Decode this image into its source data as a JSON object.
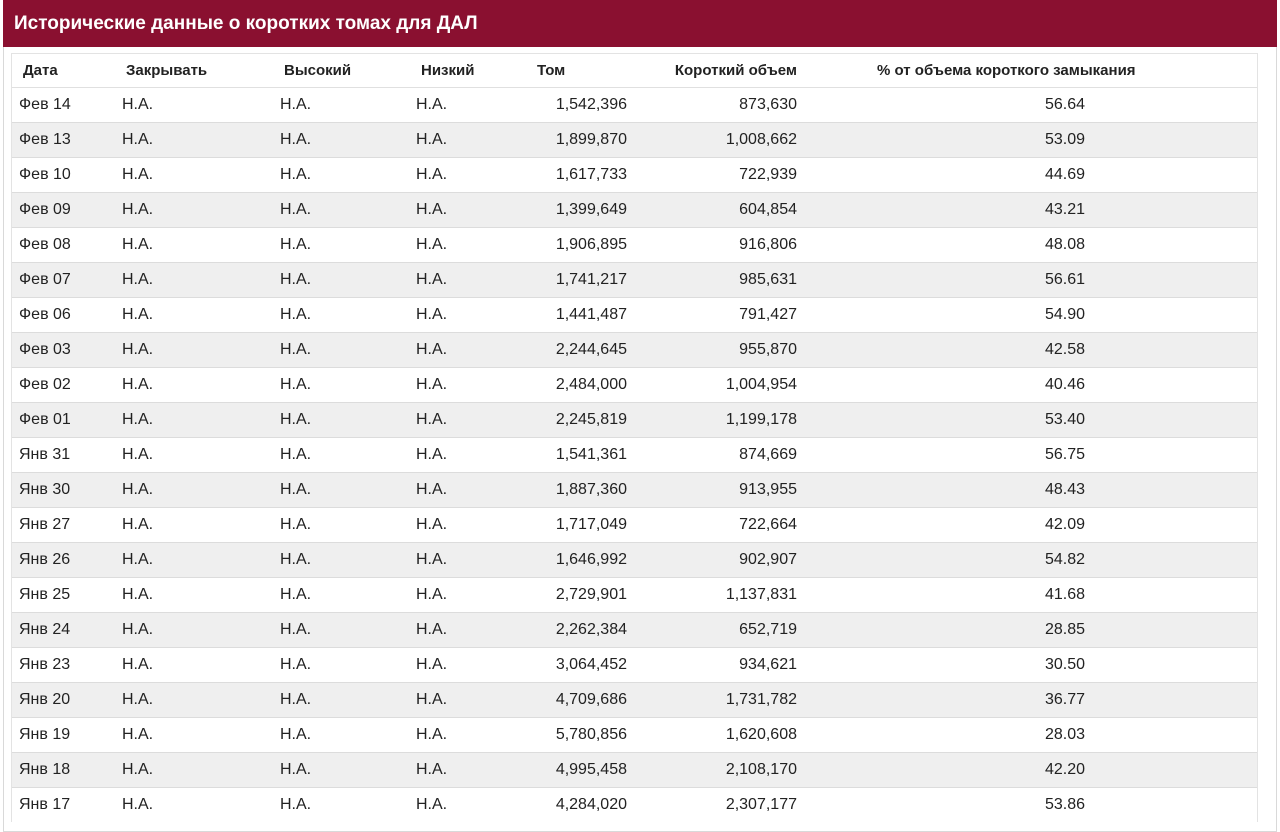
{
  "page": {
    "title": "Исторические данные о коротких томах для ДАЛ"
  },
  "table": {
    "headers": {
      "date": "Дата",
      "close": "Закрывать",
      "high": "Высокий",
      "low": "Низкий",
      "volume": "Том",
      "short_volume": "Короткий объем",
      "short_pct": "% от объема короткого замыкания"
    },
    "rows": [
      {
        "date": "Фев 14",
        "close": "Н.А.",
        "high": "Н.А.",
        "low": "Н.А.",
        "volume": "1,542,396",
        "short_volume": "873,630",
        "short_pct": "56.64"
      },
      {
        "date": "Фев 13",
        "close": "Н.А.",
        "high": "Н.А.",
        "low": "Н.А.",
        "volume": "1,899,870",
        "short_volume": "1,008,662",
        "short_pct": "53.09"
      },
      {
        "date": "Фев 10",
        "close": "Н.А.",
        "high": "Н.А.",
        "low": "Н.А.",
        "volume": "1,617,733",
        "short_volume": "722,939",
        "short_pct": "44.69"
      },
      {
        "date": "Фев 09",
        "close": "Н.А.",
        "high": "Н.А.",
        "low": "Н.А.",
        "volume": "1,399,649",
        "short_volume": "604,854",
        "short_pct": "43.21"
      },
      {
        "date": "Фев 08",
        "close": "Н.А.",
        "high": "Н.А.",
        "low": "Н.А.",
        "volume": "1,906,895",
        "short_volume": "916,806",
        "short_pct": "48.08"
      },
      {
        "date": "Фев 07",
        "close": "Н.А.",
        "high": "Н.А.",
        "low": "Н.А.",
        "volume": "1,741,217",
        "short_volume": "985,631",
        "short_pct": "56.61"
      },
      {
        "date": "Фев 06",
        "close": "Н.А.",
        "high": "Н.А.",
        "low": "Н.А.",
        "volume": "1,441,487",
        "short_volume": "791,427",
        "short_pct": "54.90"
      },
      {
        "date": "Фев 03",
        "close": "Н.А.",
        "high": "Н.А.",
        "low": "Н.А.",
        "volume": "2,244,645",
        "short_volume": "955,870",
        "short_pct": "42.58"
      },
      {
        "date": "Фев 02",
        "close": "Н.А.",
        "high": "Н.А.",
        "low": "Н.А.",
        "volume": "2,484,000",
        "short_volume": "1,004,954",
        "short_pct": "40.46"
      },
      {
        "date": "Фев 01",
        "close": "Н.А.",
        "high": "Н.А.",
        "low": "Н.А.",
        "volume": "2,245,819",
        "short_volume": "1,199,178",
        "short_pct": "53.40"
      },
      {
        "date": "Янв 31",
        "close": "Н.А.",
        "high": "Н.А.",
        "low": "Н.А.",
        "volume": "1,541,361",
        "short_volume": "874,669",
        "short_pct": "56.75"
      },
      {
        "date": "Янв 30",
        "close": "Н.А.",
        "high": "Н.А.",
        "low": "Н.А.",
        "volume": "1,887,360",
        "short_volume": "913,955",
        "short_pct": "48.43"
      },
      {
        "date": "Янв 27",
        "close": "Н.А.",
        "high": "Н.А.",
        "low": "Н.А.",
        "volume": "1,717,049",
        "short_volume": "722,664",
        "short_pct": "42.09"
      },
      {
        "date": "Янв 26",
        "close": "Н.А.",
        "high": "Н.А.",
        "low": "Н.А.",
        "volume": "1,646,992",
        "short_volume": "902,907",
        "short_pct": "54.82"
      },
      {
        "date": "Янв 25",
        "close": "Н.А.",
        "high": "Н.А.",
        "low": "Н.А.",
        "volume": "2,729,901",
        "short_volume": "1,137,831",
        "short_pct": "41.68"
      },
      {
        "date": "Янв 24",
        "close": "Н.А.",
        "high": "Н.А.",
        "low": "Н.А.",
        "volume": "2,262,384",
        "short_volume": "652,719",
        "short_pct": "28.85"
      },
      {
        "date": "Янв 23",
        "close": "Н.А.",
        "high": "Н.А.",
        "low": "Н.А.",
        "volume": "3,064,452",
        "short_volume": "934,621",
        "short_pct": "30.50"
      },
      {
        "date": "Янв 20",
        "close": "Н.А.",
        "high": "Н.А.",
        "low": "Н.А.",
        "volume": "4,709,686",
        "short_volume": "1,731,782",
        "short_pct": "36.77"
      },
      {
        "date": "Янв 19",
        "close": "Н.А.",
        "high": "Н.А.",
        "low": "Н.А.",
        "volume": "5,780,856",
        "short_volume": "1,620,608",
        "short_pct": "28.03"
      },
      {
        "date": "Янв 18",
        "close": "Н.А.",
        "high": "Н.А.",
        "low": "Н.А.",
        "volume": "4,995,458",
        "short_volume": "2,108,170",
        "short_pct": "42.20"
      },
      {
        "date": "Янв 17",
        "close": "Н.А.",
        "high": "Н.А.",
        "low": "Н.А.",
        "volume": "4,284,020",
        "short_volume": "2,307,177",
        "short_pct": "53.86"
      }
    ]
  },
  "colors": {
    "title_bar": "#8a1030",
    "title_text": "#ffffff",
    "row_alt": "#efefef",
    "row_base": "#ffffff"
  }
}
